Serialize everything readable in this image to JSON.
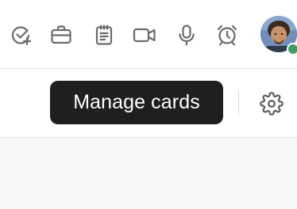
{
  "toolbar": {
    "icons": [
      {
        "name": "task-check-icon"
      },
      {
        "name": "briefcase-icon"
      },
      {
        "name": "clipboard-notes-icon"
      },
      {
        "name": "video-camera-icon"
      },
      {
        "name": "microphone-icon"
      },
      {
        "name": "alarm-clock-icon"
      }
    ],
    "presence_status_color": "#3f9f63"
  },
  "subbar": {
    "tooltip_text": "Manage cards",
    "settings_icon": "gear-icon"
  }
}
